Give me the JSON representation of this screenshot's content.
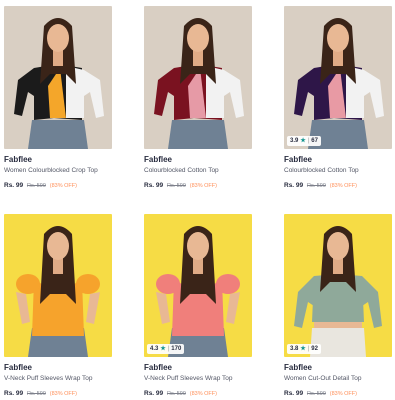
{
  "products": [
    {
      "brand": "Fabflee",
      "title": "Women Colourblocked Crop Top",
      "price": "Rs. 99",
      "mrp": "Rs. 599",
      "discount": "(83% OFF)",
      "rating": null,
      "rating_count": null,
      "bg_color": "#d9cfc3",
      "garment_colors": [
        "#1b1b1b",
        "#f4a62a",
        "#f2f2f2"
      ]
    },
    {
      "brand": "Fabflee",
      "title": "Colourblocked Cotton Top",
      "price": "Rs. 99",
      "mrp": "Rs. 599",
      "discount": "(83% OFF)",
      "rating": null,
      "rating_count": null,
      "bg_color": "#d9cfc3",
      "garment_colors": [
        "#7a1220",
        "#e69aa6",
        "#f2f2f2"
      ]
    },
    {
      "brand": "Fabflee",
      "title": "Colourblocked Cotton Top",
      "price": "Rs. 99",
      "mrp": "Rs. 599",
      "discount": "(83% OFF)",
      "rating": "3.9",
      "rating_count": "67",
      "bg_color": "#d9cfc3",
      "garment_colors": [
        "#2e1648",
        "#e89aa4",
        "#f2f2f2"
      ]
    },
    {
      "brand": "Fabflee",
      "title": "V-Neck Puff Sleeves Wrap Top",
      "price": "Rs. 99",
      "mrp": "Rs. 599",
      "discount": "(83% OFF)",
      "rating": null,
      "rating_count": null,
      "bg_color": "#f6dc45",
      "garment_colors": [
        "#f6a32c",
        "#f6a32c",
        "#f6a32c"
      ]
    },
    {
      "brand": "Fabflee",
      "title": "V-Neck Puff Sleeves Wrap Top",
      "price": "Rs. 99",
      "mrp": "Rs. 599",
      "discount": "(83% OFF)",
      "rating": "4.3",
      "rating_count": "170",
      "bg_color": "#f6dc45",
      "garment_colors": [
        "#f07f7b",
        "#f07f7b",
        "#f07f7b"
      ]
    },
    {
      "brand": "Fabflee",
      "title": "Women Cut-Out Detail Top",
      "price": "Rs. 99",
      "mrp": "Rs. 599",
      "discount": "(83% OFF)",
      "rating": "3.8",
      "rating_count": "92",
      "bg_color": "#f6dc45",
      "garment_colors": [
        "#8fa99a",
        "#8fa99a",
        "#8fa99a"
      ]
    }
  ],
  "icons": {
    "rating_star": "star-icon"
  },
  "colors": {
    "brand_text": "#282c3f",
    "discount": "#ff905a",
    "rating_star": "#14958f"
  }
}
